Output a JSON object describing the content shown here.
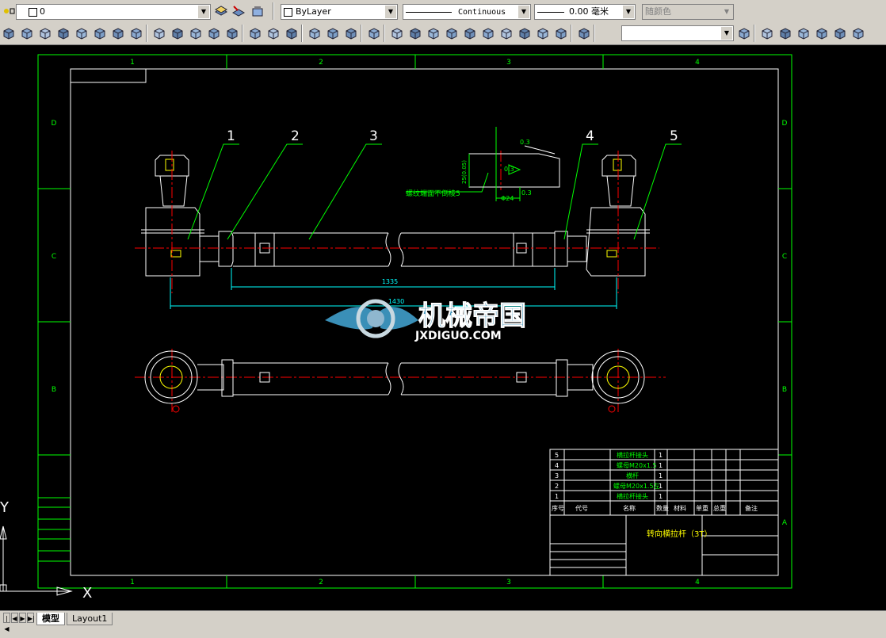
{
  "toolbar_layers": {
    "layer_value": "0",
    "color_value": "ByLayer",
    "linetype_value": "Continuous",
    "lineweight_value": "0.00 毫米",
    "plotstyle_value": "随颜色"
  },
  "toolbar_icons_row1": [
    "layer-manager-icon",
    "make-current-icon",
    "layer-previous-icon"
  ],
  "toolbar_icons_row2": [
    "wedge-icon",
    "cone-icon",
    "sphere-icon",
    "cylinder-icon",
    "torus-icon",
    "pyramid-icon",
    "helix-icon",
    "planar-surface-icon",
    "extrude-icon",
    "revolve-icon",
    "sweep-icon",
    "loft-icon",
    "presspull-icon",
    "union-icon",
    "subtract-icon",
    "intersect-icon",
    "3d-move-icon",
    "3d-rotate-icon",
    "3d-align-icon",
    "ucs-icon",
    "view-top-icon",
    "view-bottom-icon",
    "view-left-icon",
    "view-right-icon",
    "view-front-icon",
    "view-back-icon",
    "iso-sw-icon",
    "iso-se-icon",
    "iso-ne-icon",
    "iso-nw-icon",
    "camera-icon",
    "visual-style-icon",
    "text-style-icon",
    "wireframe-icon",
    "hidden-icon",
    "conceptual-icon",
    "realistic-icon",
    "layer-props-icon"
  ],
  "drawing": {
    "grid_columns": [
      "1",
      "2",
      "3",
      "4"
    ],
    "grid_rows": [
      "D",
      "C",
      "B",
      "A"
    ],
    "balloons": [
      "1",
      "2",
      "3",
      "4",
      "5"
    ],
    "dim_inner": "1335",
    "dim_outer": "1430",
    "note_text": "螺纹端面不倒棱5",
    "detail_dim_1": "0.3",
    "detail_dim_2": "0.3",
    "detail_dim_3": "0.3",
    "detail_dim_vert": "25(0.05)",
    "detail_dim_d": "Φ24",
    "watermark_title": "机械帝国",
    "watermark_url": "JXDIGUO.COM",
    "bom_rows": [
      {
        "no": "5",
        "name": "横拉杆接头",
        "qty": "1"
      },
      {
        "no": "4",
        "name": "螺母M20x1.5",
        "qty": "1"
      },
      {
        "no": "3",
        "name": "横杆",
        "qty": "1"
      },
      {
        "no": "2",
        "name": "螺母M20x1.5左",
        "qty": "1"
      },
      {
        "no": "1",
        "name": "横拉杆接头",
        "qty": "1"
      }
    ],
    "bom_header": [
      "序号",
      "代号",
      "名称",
      "数量",
      "材料",
      "单重",
      "总重",
      "备注"
    ],
    "title_block_name": "转向横拉杆（3T）",
    "ucs_x": "X",
    "ucs_y": "Y"
  },
  "tabs": {
    "model": "模型",
    "layout1": "Layout1"
  },
  "colors": {
    "frame": "#00ff00",
    "part": "#ffffff",
    "center": "#ff0000",
    "dim": "#00ffff",
    "text": "#ffff00"
  }
}
